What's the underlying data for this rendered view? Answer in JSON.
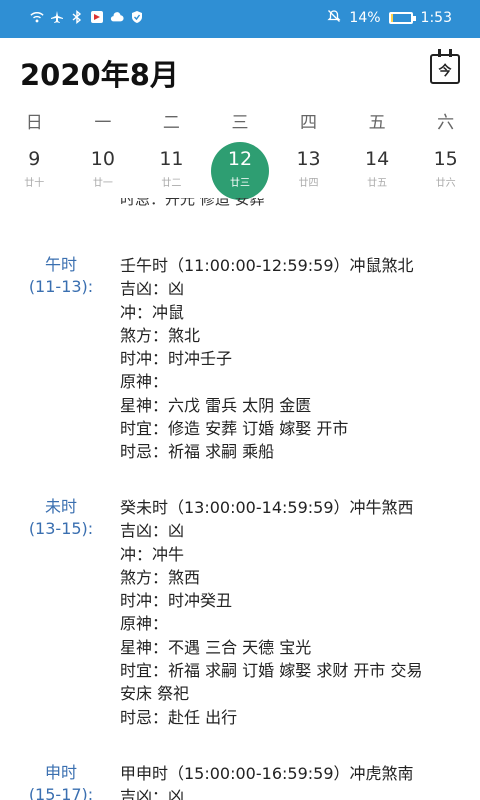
{
  "statusbar": {
    "battery_text": "14%",
    "battery_level": 0.14,
    "time": "1:53",
    "icons": [
      "wifi-icon",
      "airplane-icon",
      "bluetooth-icon",
      "app-icon",
      "cloud-icon",
      "shield-icon"
    ]
  },
  "header": {
    "title": "2020年8月",
    "today_label": "今"
  },
  "weekdays": [
    "日",
    "一",
    "二",
    "三",
    "四",
    "五",
    "六"
  ],
  "dates": [
    {
      "num": "9",
      "lunar": "廿十"
    },
    {
      "num": "10",
      "lunar": "廿一"
    },
    {
      "num": "11",
      "lunar": "廿二"
    },
    {
      "num": "12",
      "lunar": "廿三"
    },
    {
      "num": "13",
      "lunar": "廿四"
    },
    {
      "num": "14",
      "lunar": "廿五"
    },
    {
      "num": "15",
      "lunar": "廿六"
    }
  ],
  "selected_index": 3,
  "content": {
    "cutoff_line": "时忌：开光 修造 安葬",
    "blocks": [
      {
        "hour": "午时",
        "range": "(11-13):",
        "lines": [
          "壬午时（11:00:00-12:59:59）冲鼠煞北",
          "吉凶：凶",
          "冲：冲鼠",
          "煞方：煞北",
          "时冲：时冲壬子",
          "原神：",
          "星神：六戊 雷兵 太阴 金匮",
          "时宜：修造 安葬 订婚 嫁娶 开市",
          "时忌：祈福 求嗣 乘船"
        ]
      },
      {
        "hour": "未时",
        "range": "(13-15):",
        "lines": [
          "癸未时（13:00:00-14:59:59）冲牛煞西",
          "吉凶：凶",
          "冲：冲牛",
          "煞方：煞西",
          "时冲：时冲癸丑",
          "原神：",
          "星神：不遇 三合 天德 宝光",
          "时宜：祈福 求嗣 订婚 嫁娶 求财 开市 交易",
          "安床 祭祀",
          "时忌：赴任 出行"
        ]
      },
      {
        "hour": "申时",
        "range": "(15-17):",
        "lines": [
          "甲申时（15:00:00-16:59:59）冲虎煞南",
          "吉凶：凶"
        ]
      }
    ]
  }
}
